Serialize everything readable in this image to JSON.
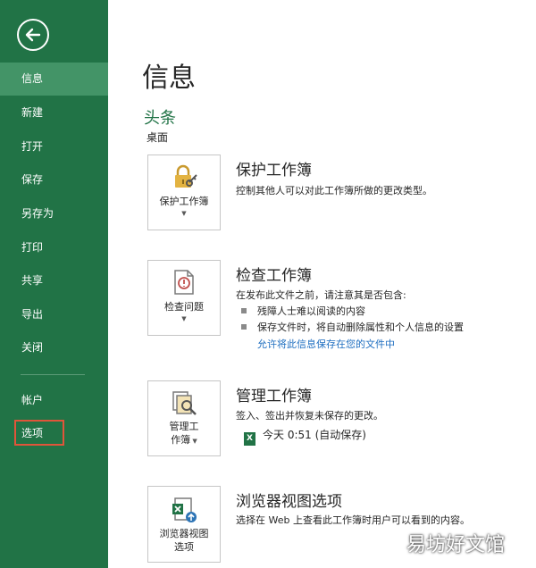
{
  "sidebar": {
    "back_icon": "arrow-left-circle-icon",
    "items": [
      {
        "label": "信息"
      },
      {
        "label": "新建"
      },
      {
        "label": "打开"
      },
      {
        "label": "保存"
      },
      {
        "label": "另存为"
      },
      {
        "label": "打印"
      },
      {
        "label": "共享"
      },
      {
        "label": "导出"
      },
      {
        "label": "关闭"
      },
      {
        "label": "帐户"
      },
      {
        "label": "选项"
      }
    ],
    "colors": {
      "background": "#217346",
      "active": "#439467",
      "highlight_border": "#e0553a"
    }
  },
  "main": {
    "title": "信息",
    "doc_name": "头条",
    "doc_path": "桌面",
    "sections": [
      {
        "button_label": "保护工作簿",
        "icon": "lock-key-icon",
        "title": "保护工作簿",
        "desc": "控制其他人可以对此工作簿所做的更改类型。"
      },
      {
        "button_label": "检查问题",
        "icon": "inspect-document-icon",
        "title": "检查工作簿",
        "desc": "在发布此文件之前，请注意其是否包含:",
        "bullets": [
          "残障人士难以阅读的内容",
          "保存文件时，将自动删除属性和个人信息的设置"
        ],
        "link": "允许将此信息保存在您的文件中"
      },
      {
        "button_label_1": "管理工",
        "button_label_2": "作簿",
        "icon": "manage-workbook-icon",
        "title": "管理工作簿",
        "desc": "签入、签出并恢复未保存的更改。",
        "autosave": "今天 0:51 (自动保存)"
      },
      {
        "button_label_1": "浏览器视图",
        "button_label_2": "选项",
        "icon": "browser-view-icon",
        "title": "浏览器视图选项",
        "desc": "选择在 Web 上查看此工作簿时用户可以看到的内容。"
      }
    ],
    "accent_color": "#217346",
    "link_color": "#1e6ec0"
  },
  "watermark": "易坊好文馆"
}
